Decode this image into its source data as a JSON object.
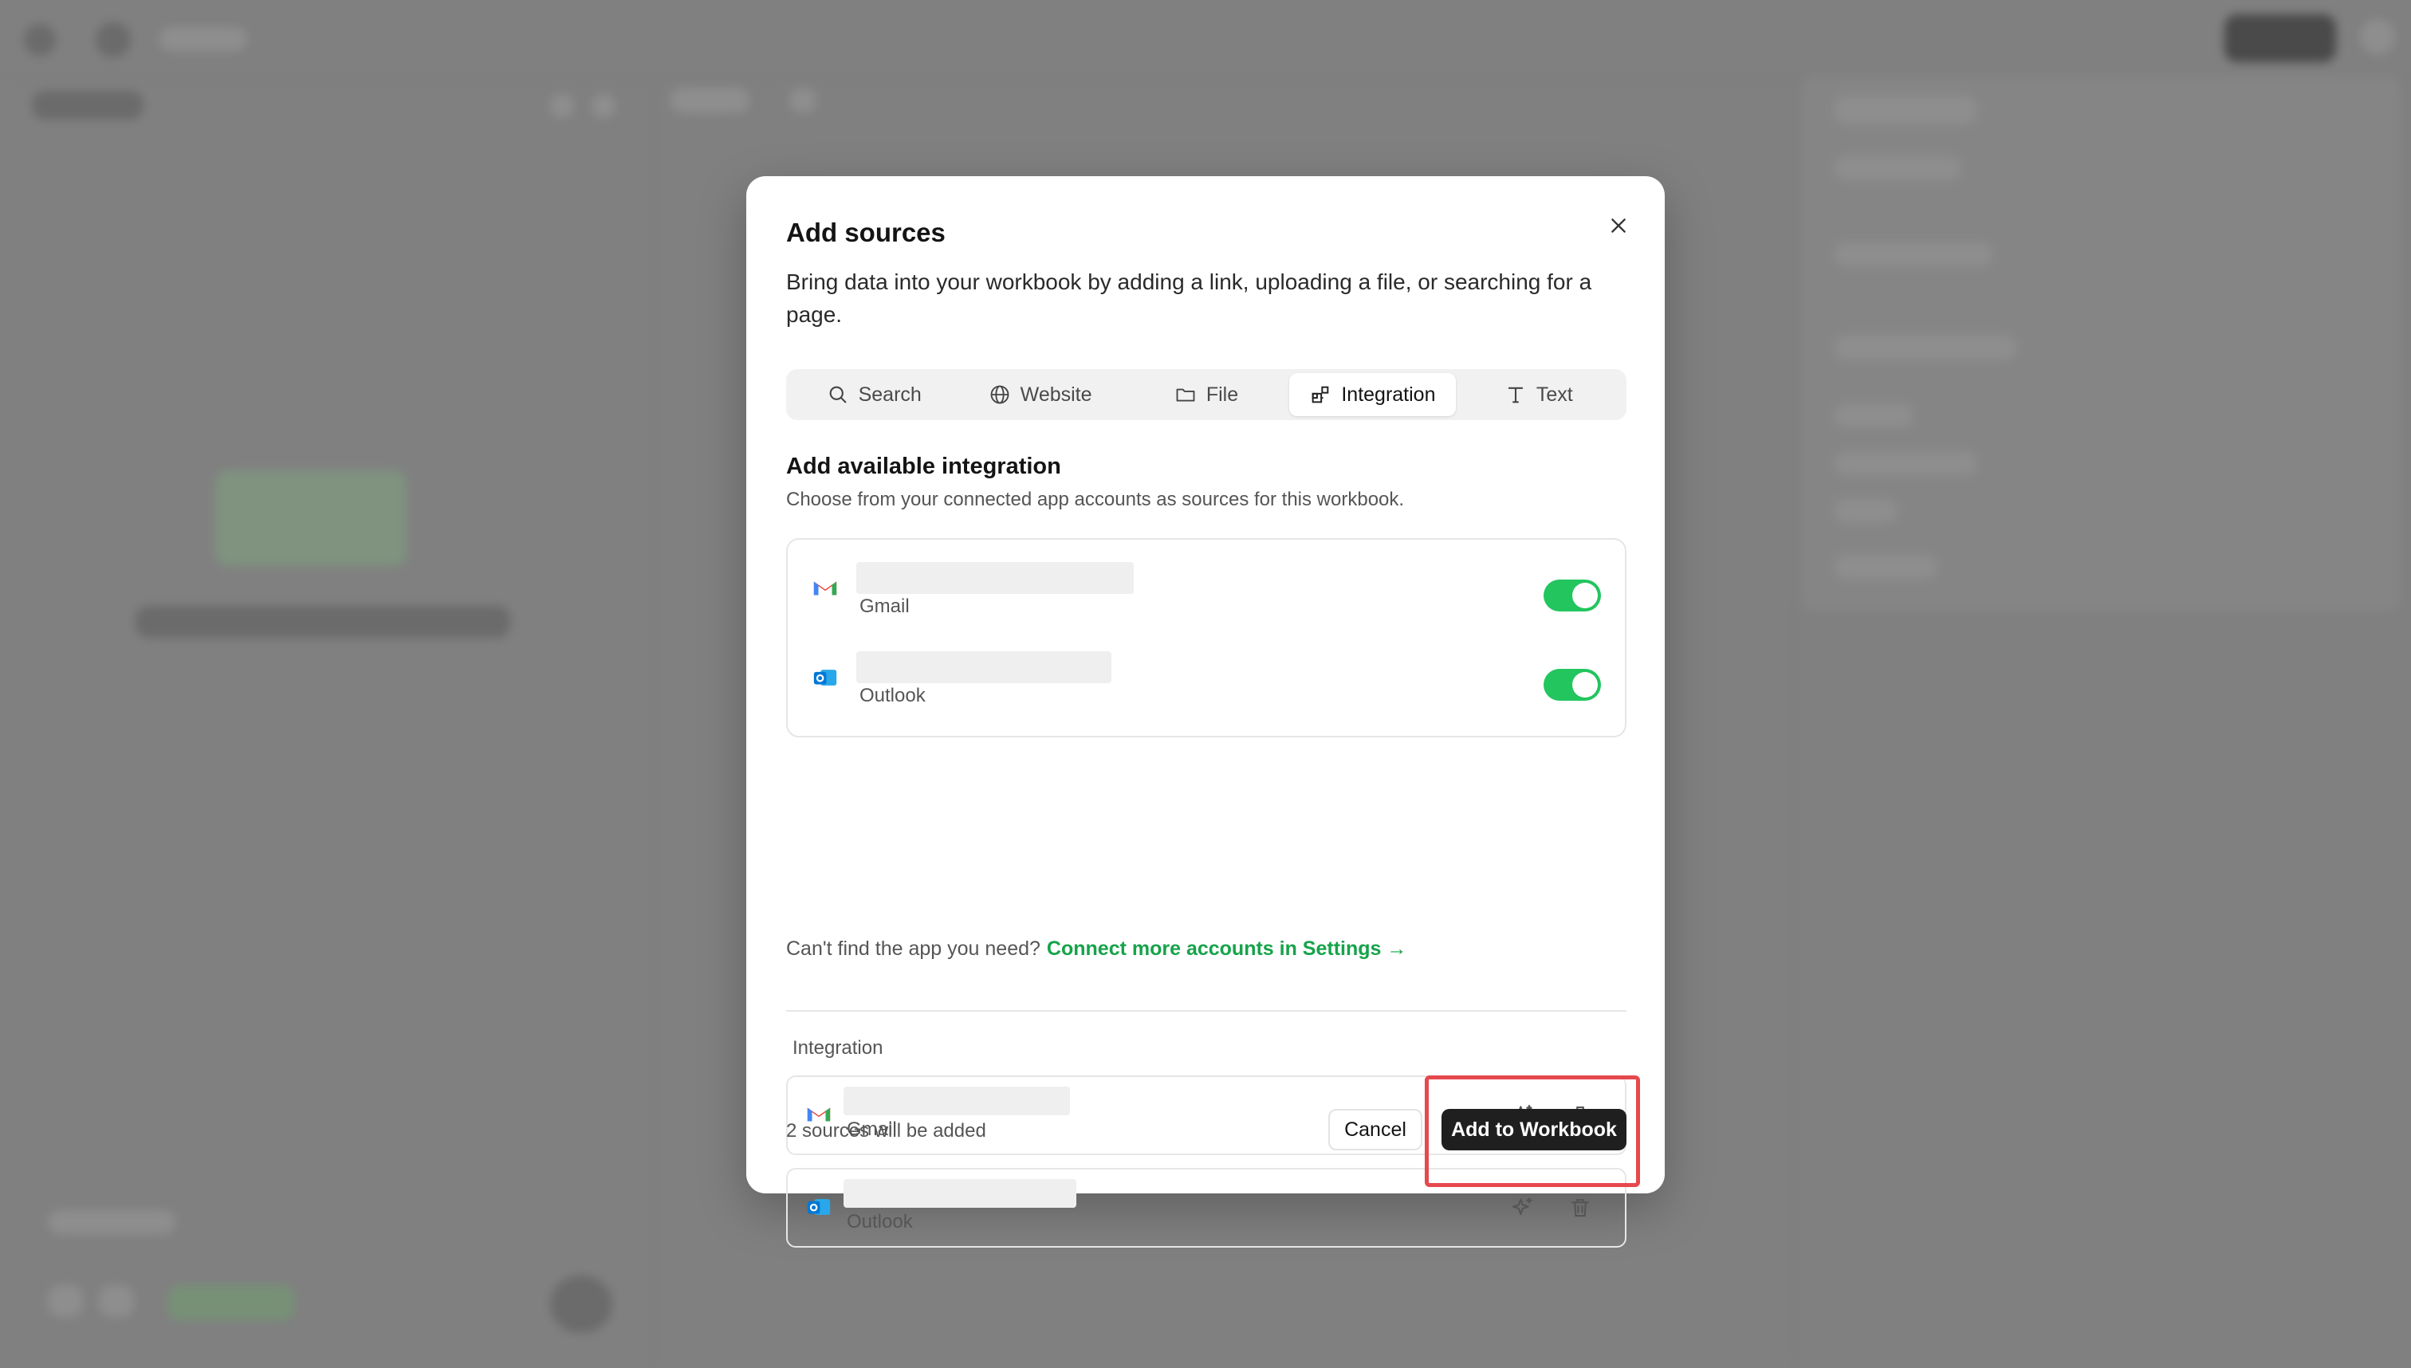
{
  "modal": {
    "title": "Add sources",
    "description": "Bring data into your workbook by adding a link, uploading a file, or searching for a page."
  },
  "tabs": [
    {
      "label": "Search",
      "icon": "search-icon",
      "active": false
    },
    {
      "label": "Website",
      "icon": "globe-icon",
      "active": false
    },
    {
      "label": "File",
      "icon": "folder-icon",
      "active": false
    },
    {
      "label": "Integration",
      "icon": "integration-icon",
      "active": true
    },
    {
      "label": "Text",
      "icon": "text-icon",
      "active": false
    }
  ],
  "available": {
    "title": "Add available integration",
    "subtitle": "Choose from your connected app accounts as sources for this workbook.",
    "accounts": [
      {
        "app": "Gmail",
        "icon": "gmail-icon",
        "enabled": true
      },
      {
        "app": "Outlook",
        "icon": "outlook-icon",
        "enabled": true
      }
    ],
    "help_text": "Can't find the app you need?",
    "help_link": "Connect more accounts in Settings →"
  },
  "integration": {
    "label": "Integration",
    "items": [
      {
        "app": "Gmail",
        "icon": "gmail-icon"
      },
      {
        "app": "Outlook",
        "icon": "outlook-icon"
      }
    ]
  },
  "footer": {
    "count_text": "2 sources will be added",
    "cancel_label": "Cancel",
    "add_label": "Add to Workbook"
  },
  "colors": {
    "accent_green": "#22c55e",
    "link_green": "#16a34a",
    "primary_button": "#1f1f1f",
    "highlight": "#e5484d"
  }
}
